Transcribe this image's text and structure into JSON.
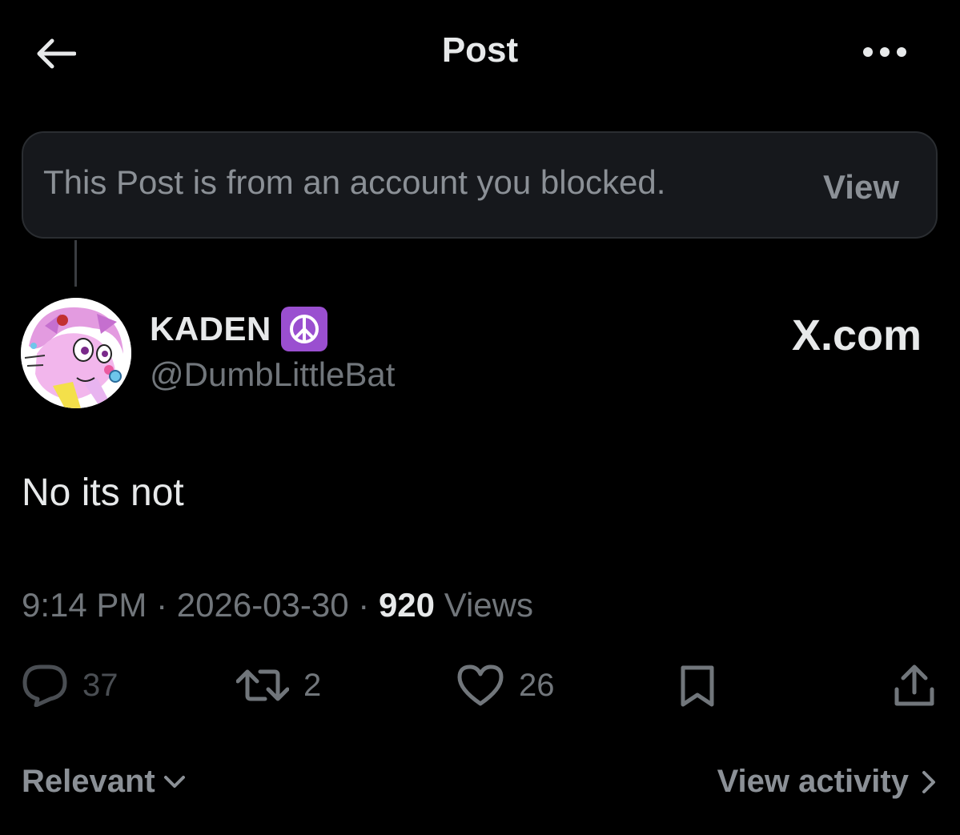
{
  "header": {
    "title": "Post",
    "back_icon": "arrow-left-icon",
    "more_icon": "more-horizontal-icon"
  },
  "blocked_banner": {
    "message": "This Post is from an account you blocked.",
    "view_label": "View"
  },
  "author": {
    "name": "KADEN",
    "badge_icon": "peace-symbol-icon",
    "badge_color": "#9a4fd0",
    "handle": "@DumbLittleBat",
    "source": "X.com"
  },
  "post": {
    "text": "No its not",
    "time": "9:14 PM",
    "date": "2026-03-30",
    "separator": "·",
    "views_count": "920",
    "views_label": "Views"
  },
  "actions": {
    "replies": "37",
    "reposts": "2",
    "likes": "26"
  },
  "footer": {
    "sort_label": "Relevant",
    "activity_label": "View activity"
  },
  "colors": {
    "background": "#000000",
    "primary_text": "#e7e9ea",
    "secondary_text": "#71767b",
    "banner_bg": "#16181c"
  }
}
